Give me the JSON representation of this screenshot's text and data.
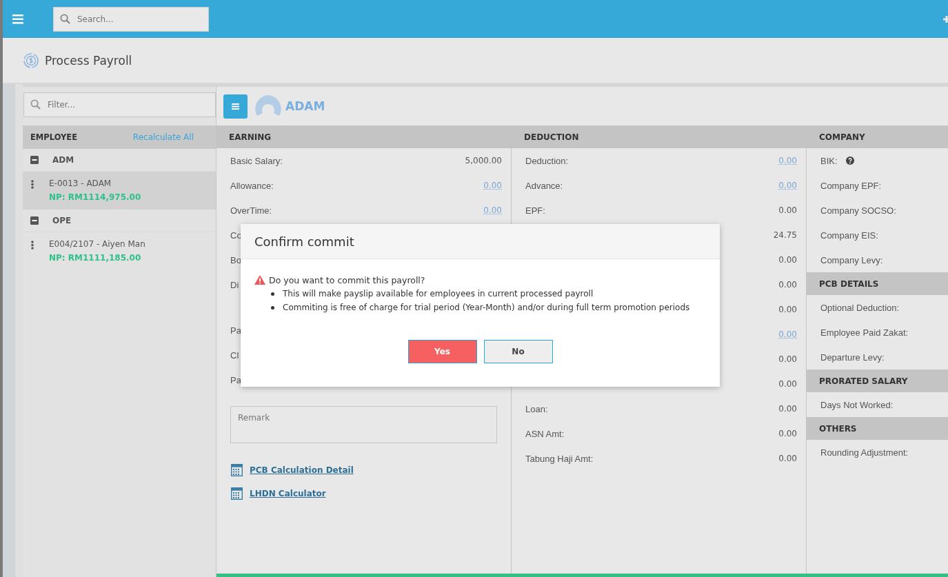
{
  "topbar": {
    "search": {
      "placeholder": "Search..."
    }
  },
  "page": {
    "title": "Process Payroll"
  },
  "employees": {
    "filter": {
      "placeholder": "Filter..."
    },
    "header": "EMPLOYEE",
    "action": "Recalculate All",
    "groups": [
      {
        "code": "ADM",
        "expanded": true,
        "items": [
          {
            "name": "E-0013 - ADAM",
            "np": "NP: RM1114,975.00",
            "selected": true
          }
        ]
      },
      {
        "code": "OPE",
        "expanded": true,
        "items": [
          {
            "name": "E004/2107 - Aiyen Man",
            "np": "NP: RM1111,185.00",
            "selected": false
          }
        ]
      }
    ]
  },
  "employee": {
    "name": "ADAM"
  },
  "earning": {
    "title": "EARNING",
    "rows": [
      {
        "kind": "row",
        "label": "Basic Salary:",
        "value": "5,000.00",
        "link": false
      },
      {
        "kind": "row",
        "label": "Allowance:",
        "value": "0.00",
        "link": true
      },
      {
        "kind": "row",
        "label": "OverTime:",
        "value": "0.00",
        "link": true
      },
      {
        "kind": "row",
        "label": "Co"
      },
      {
        "kind": "row",
        "label": "Bo"
      },
      {
        "kind": "tall",
        "label": "Di"
      },
      {
        "kind": "row",
        "label": "Pa"
      },
      {
        "kind": "row",
        "label": "Cl"
      },
      {
        "kind": "row",
        "label": "Pa"
      }
    ],
    "remark": {
      "placeholder": "Remark"
    },
    "links": [
      "PCB Calculation Detail",
      "LHDN Calculator"
    ]
  },
  "deduction": {
    "title": "DEDUCTION",
    "rows": [
      {
        "label": "Deduction:",
        "value": "0.00",
        "link": true
      },
      {
        "label": "Advance:",
        "value": "0.00",
        "link": true
      },
      {
        "label": "EPF:",
        "value": "0.00",
        "link": false
      },
      {
        "value": "24.75",
        "link": false
      },
      {
        "value": "0.00",
        "link": false
      },
      {
        "value": "0.00",
        "link": false
      },
      {
        "value": "0.00",
        "link": false
      },
      {
        "value": "0.00",
        "link": true
      },
      {
        "value": "0.00",
        "link": false
      },
      {
        "value": "0.00",
        "link": false
      },
      {
        "label": "Loan:",
        "value": "0.00",
        "link": false
      },
      {
        "label": "ASN Amt:",
        "value": "0.00",
        "link": false
      },
      {
        "label": "Tabung Haji Amt:",
        "value": "0.00",
        "link": false
      }
    ]
  },
  "company": {
    "sections": [
      {
        "title": "COMPANY",
        "rows": [
          {
            "label": "BIK:",
            "help": true
          },
          {
            "label": "Company EPF:",
            "help": false
          },
          {
            "label": "Company SOCSO:",
            "help": false
          },
          {
            "label": "Company EIS:",
            "help": false
          },
          {
            "label": "Company Levy:",
            "help": false
          }
        ]
      },
      {
        "title": "PCB DETAILS",
        "rows": [
          {
            "label": "Optional Deduction:",
            "help": false
          },
          {
            "label": "Employee Paid Zakat:",
            "help": false
          },
          {
            "label": "Departure Levy:",
            "help": false
          }
        ]
      },
      {
        "title": "PRORATED SALARY",
        "rows": [
          {
            "label": "Days Not Worked:",
            "help": false
          }
        ]
      },
      {
        "title": "OTHERS",
        "rows": [
          {
            "label": "Rounding Adjustment:",
            "help": false
          }
        ]
      }
    ]
  },
  "dialog": {
    "title": "Confirm commit",
    "question": "Do you want to commit this payroll?",
    "bullets": [
      "This will make payslip available for employees in current processed payroll",
      "Commiting is free of charge for trial period (Year-Month) and/or during full term promotion periods"
    ],
    "buttons": [
      {
        "label": "Yes",
        "kind": "primary"
      },
      {
        "label": "No",
        "kind": "default"
      }
    ]
  }
}
